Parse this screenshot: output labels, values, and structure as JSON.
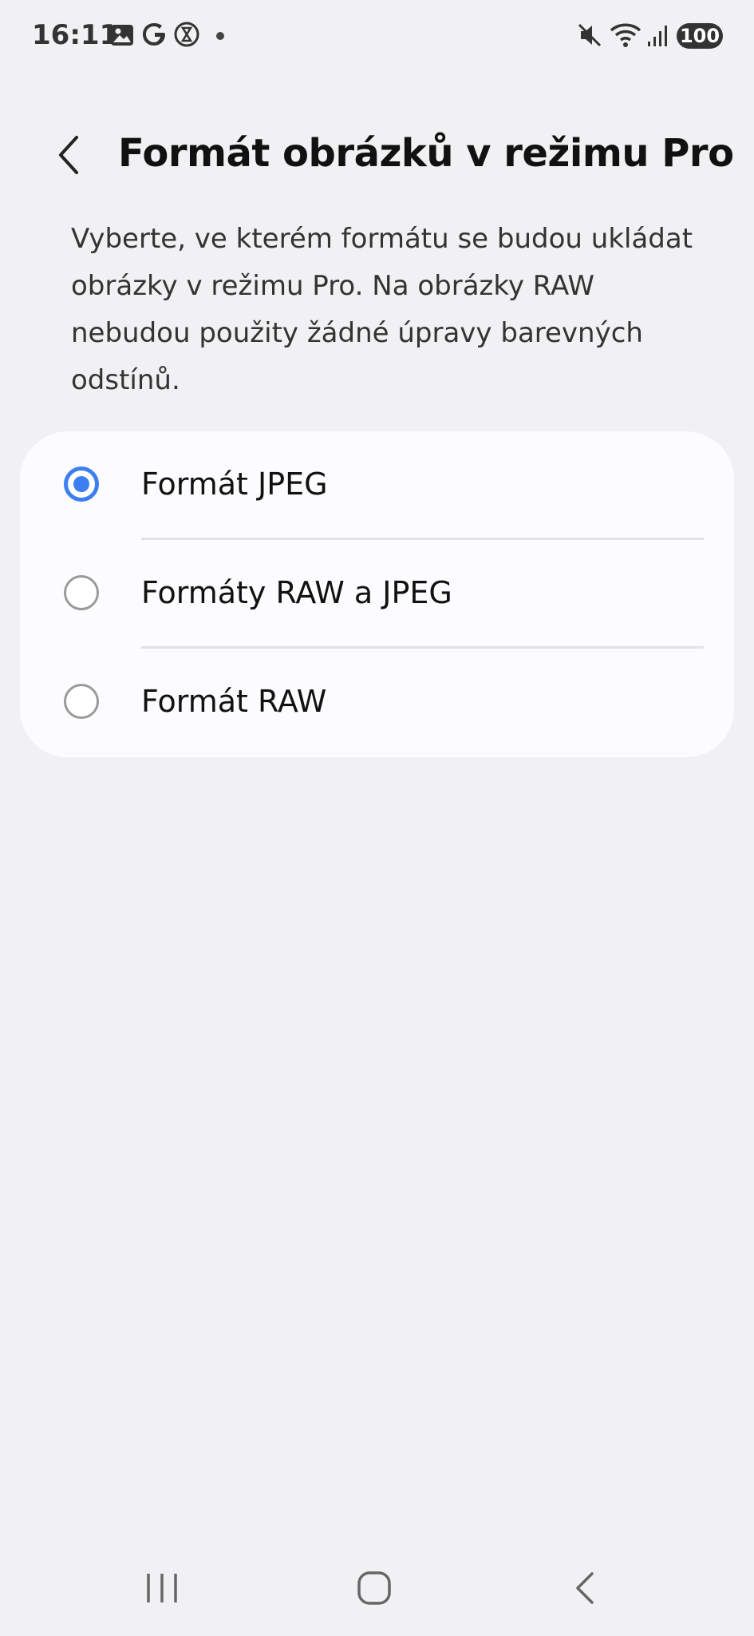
{
  "status_bar": {
    "time": "16:11",
    "icons": [
      "gallery-icon",
      "google-icon",
      "timer-icon",
      "dot-icon",
      "mute-icon",
      "wifi-icon",
      "signal-icon"
    ],
    "battery": "100"
  },
  "header": {
    "back_icon": "chevron-left-icon",
    "title": "Formát obrázků v režimu Pro"
  },
  "description": "Vyberte, ve kterém formátu se budou ukládat obrázky v režimu Pro. Na obrázky RAW nebudou použity žádné úpravy barevných odstínů.",
  "options": [
    {
      "label": "Formát JPEG",
      "selected": true
    },
    {
      "label": "Formáty RAW a JPEG",
      "selected": false
    },
    {
      "label": "Formát RAW",
      "selected": false
    }
  ],
  "colors": {
    "accent": "#3d7ef0",
    "background": "#f1f1f3",
    "card": "#fcfcfe"
  },
  "nav_bar": {
    "buttons": [
      "recent-apps-icon",
      "home-icon",
      "back-icon"
    ]
  }
}
